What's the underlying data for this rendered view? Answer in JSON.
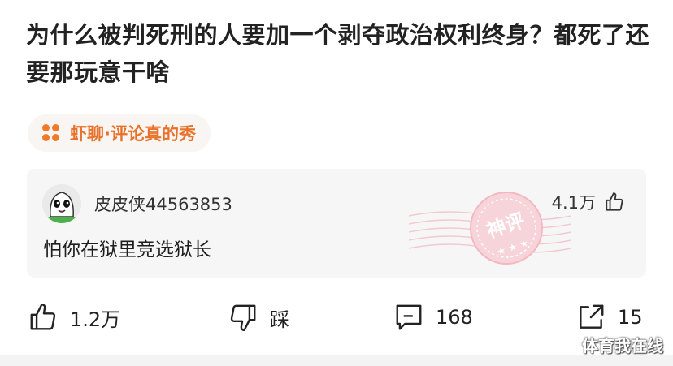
{
  "post": {
    "title": "为什么被判死刑的人要加一个剥夺政治权利终身？都死了还要那玩意干啥"
  },
  "source_tag": {
    "icon": "four-dots-icon",
    "label": "虾聊·评论真的秀",
    "color": "#e8722a"
  },
  "top_comment": {
    "username": "皮皮侠44563853",
    "text": "怕你在狱里竞选狱长",
    "like_count": "4.1万",
    "stamp_label": "神评",
    "avatar_icon": "cartoon-face-avatar"
  },
  "actions": {
    "like_label": "1.2万",
    "dislike_label": "踩",
    "comment_label": "168",
    "share_label": "15"
  },
  "watermark": "体育我在线"
}
